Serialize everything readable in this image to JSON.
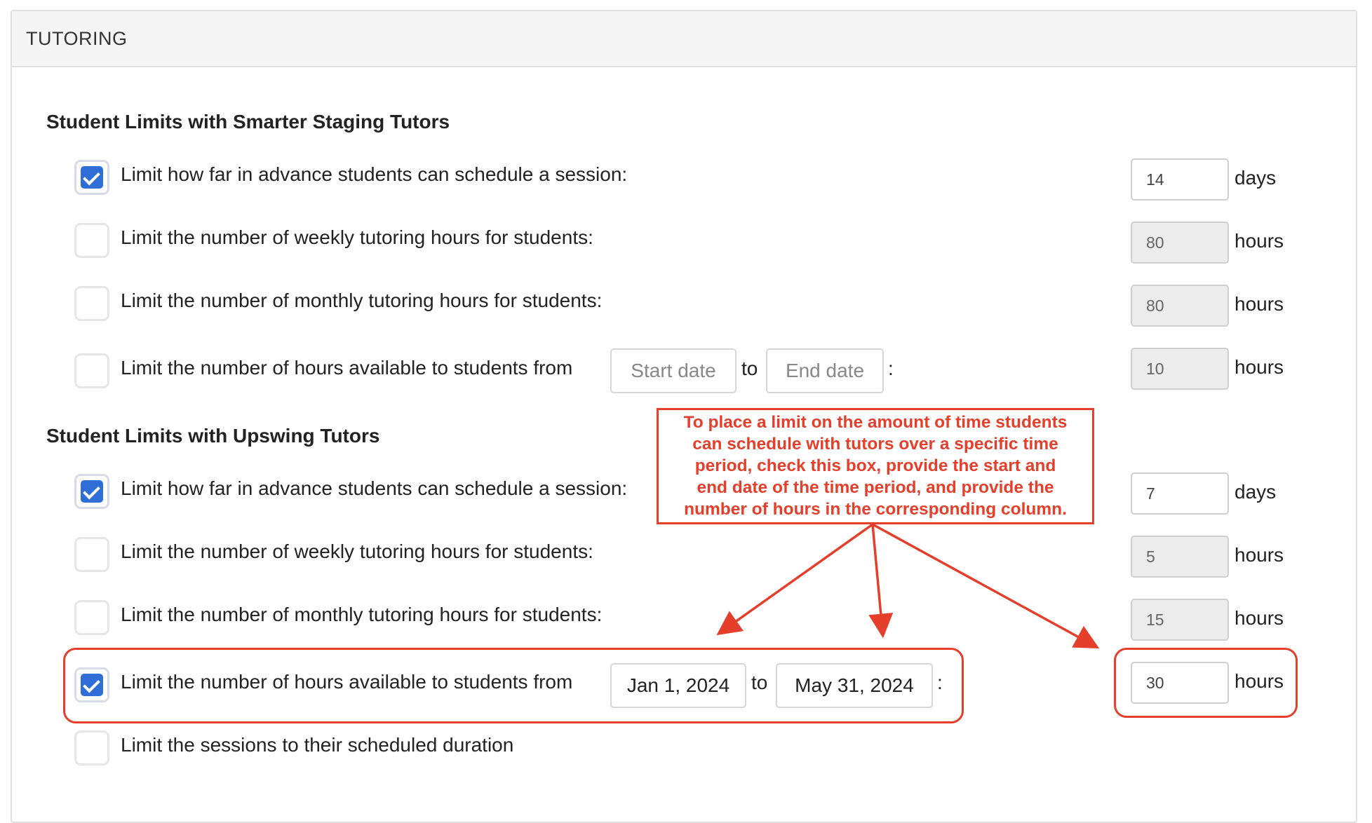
{
  "panel": {
    "title": "TUTORING"
  },
  "sections": [
    {
      "title": "Student Limits with Smarter Staging Tutors",
      "rows": [
        {
          "checked": true,
          "label": "Limit how far in advance students can schedule a session:",
          "value": "14",
          "unit": "days",
          "disabled": false
        },
        {
          "checked": false,
          "label": "Limit the number of weekly tutoring hours for students:",
          "value": "80",
          "unit": "hours",
          "disabled": true
        },
        {
          "checked": false,
          "label": "Limit the number of monthly tutoring hours for students:",
          "value": "80",
          "unit": "hours",
          "disabled": true
        },
        {
          "checked": false,
          "label": "Limit the number of hours available to students from",
          "start_placeholder": "Start date",
          "to_text": "to",
          "end_placeholder": "End date",
          "colon": ":",
          "value": "10",
          "unit": "hours",
          "disabled": true
        }
      ]
    },
    {
      "title": "Student Limits with Upswing Tutors",
      "rows": [
        {
          "checked": true,
          "label": "Limit how far in advance students can schedule a session:",
          "value": "7",
          "unit": "days",
          "disabled": false
        },
        {
          "checked": false,
          "label": "Limit the number of weekly tutoring hours for students:",
          "value": "5",
          "unit": "hours",
          "disabled": true
        },
        {
          "checked": false,
          "label": "Limit the number of monthly tutoring hours for students:",
          "value": "15",
          "unit": "hours",
          "disabled": true
        },
        {
          "checked": true,
          "label": "Limit the number of hours available to students from",
          "start_value": "Jan 1, 2024",
          "to_text": "to",
          "end_value": "May 31, 2024",
          "colon": ":",
          "value": "30",
          "unit": "hours",
          "disabled": false
        },
        {
          "checked": false,
          "label": "Limit the sessions to their scheduled duration"
        }
      ]
    }
  ],
  "annotation": {
    "lines": [
      "To place a limit on the amount of time students",
      "can schedule with tutors over a specific time",
      "period, check this box, provide the start and",
      "end date of the time period, and provide the",
      "number of hours in the corresponding column."
    ],
    "color": "#e53f2c"
  }
}
